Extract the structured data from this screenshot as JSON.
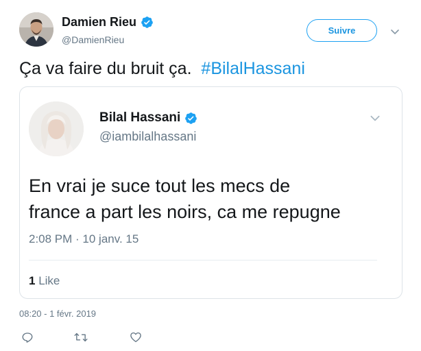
{
  "author": {
    "name": "Damien Rieu",
    "handle": "@DamienRieu"
  },
  "follow_label": "Suivre",
  "tweet": {
    "text": "Ça va faire du bruit ça.",
    "hashtag": "#BilalHassani"
  },
  "quoted": {
    "name": "Bilal Hassani",
    "handle": "@iambilalhassani",
    "text_lines": [
      "En vrai je suce tout les mecs de",
      "france a part les noirs, ca me repugne"
    ],
    "time": "2:08 PM · 10 janv. 15",
    "likes_count": "1",
    "likes_label": "Like"
  },
  "timestamp": "08:20 - 1 févr. 2019",
  "icons": {
    "verified": "verified-badge-icon",
    "caret": "chevron-down-icon",
    "reply": "reply-icon",
    "retweet": "retweet-icon",
    "like": "heart-icon"
  },
  "colors": {
    "accent": "#1da1f2",
    "link": "#1b95e0",
    "muted": "#657786",
    "text": "#14171a",
    "border": "#dde3e8"
  }
}
